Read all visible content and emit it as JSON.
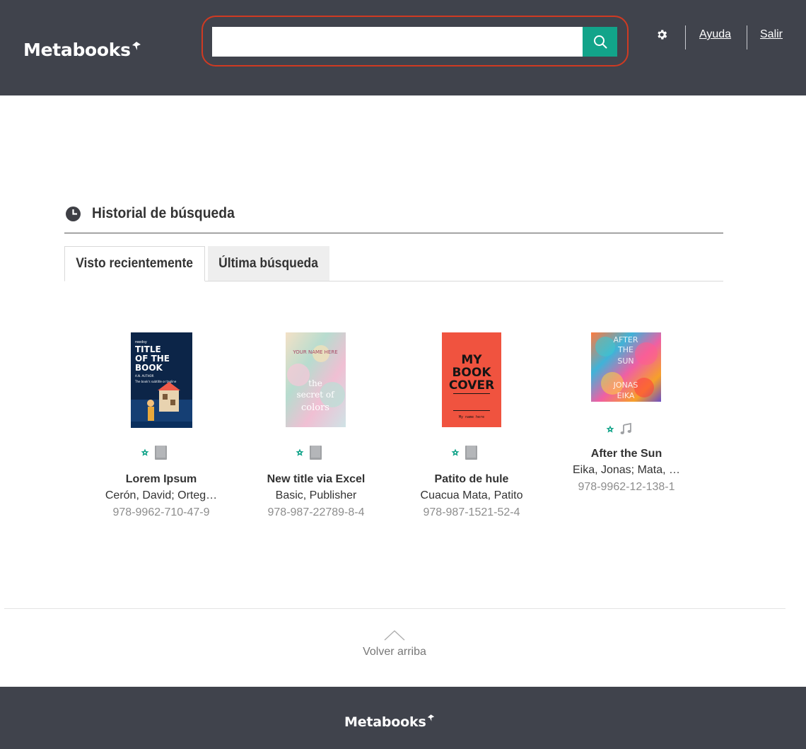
{
  "header": {
    "logo": "Metabooks",
    "search": {
      "value": "",
      "placeholder": ""
    },
    "links": {
      "help": "Ayuda",
      "logout": "Salir"
    }
  },
  "history": {
    "title": "Historial de búsqueda",
    "tabs": [
      {
        "label": "Visto recientemente",
        "active": true
      },
      {
        "label": "Última búsqueda",
        "active": false
      }
    ]
  },
  "books": [
    {
      "title": "Lorem Ipsum",
      "author": "Cerón, David; Orteg…",
      "isbn": "978-9962-710-47-9",
      "format_icon": "book-icon",
      "cover": {
        "brand": "reedsy",
        "lines": [
          "TITLE",
          "OF THE",
          "BOOK"
        ],
        "author": "A.N. AUTHOR",
        "subtitle": "The book's subtitle or tagline"
      }
    },
    {
      "title": "New title via Excel",
      "author": "Basic, Publisher",
      "isbn": "978-987-22789-8-4",
      "format_icon": "book-icon",
      "cover": {
        "top": "YOUR NAME HERE",
        "lines": [
          "the",
          "secret of",
          "colors"
        ]
      }
    },
    {
      "title": "Patito de hule",
      "author": "Cuacua Mata, Patito",
      "isbn": "978-987-1521-52-4",
      "format_icon": "book-icon",
      "cover": {
        "lines": [
          "MY",
          "BOOK",
          "COVER"
        ],
        "author": "My name here"
      }
    },
    {
      "title": "After the Sun",
      "author": "Eika, Jonas; Mata, …",
      "isbn": "978-9962-12-138-1",
      "format_icon": "music-note-icon",
      "cover": {
        "lines": [
          "AFTER",
          "THE",
          "SUN",
          "JONAS",
          "EIKA"
        ]
      }
    }
  ],
  "footer": {
    "back_to_top": "Volver arriba",
    "logo": "Metabooks"
  },
  "colors": {
    "header_bg": "#40434c",
    "accent": "#12a48a",
    "highlight_outline": "#d03a22"
  }
}
